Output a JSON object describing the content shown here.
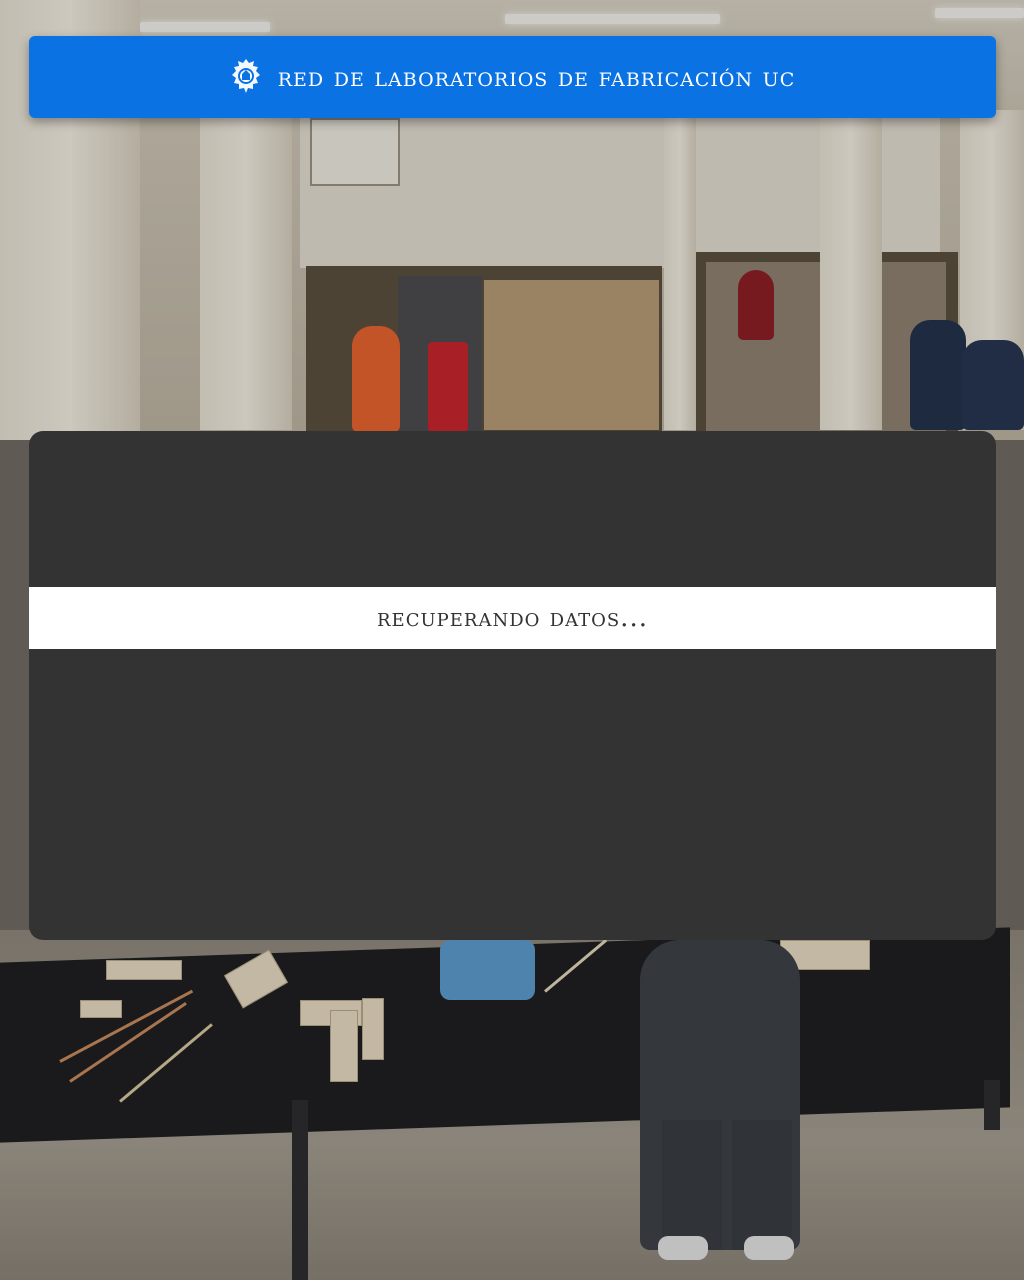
{
  "header": {
    "title": "RED DE LABORATORIOS DE FABRICACIÓN UC",
    "logo_icon": "uc-crest-icon",
    "background_color": "#0a72e3",
    "text_color": "#ffffff"
  },
  "loading_panel": {
    "status_text": "RECUPERANDO DATOS...",
    "panel_color": "#333333",
    "strip_color": "#ffffff"
  }
}
